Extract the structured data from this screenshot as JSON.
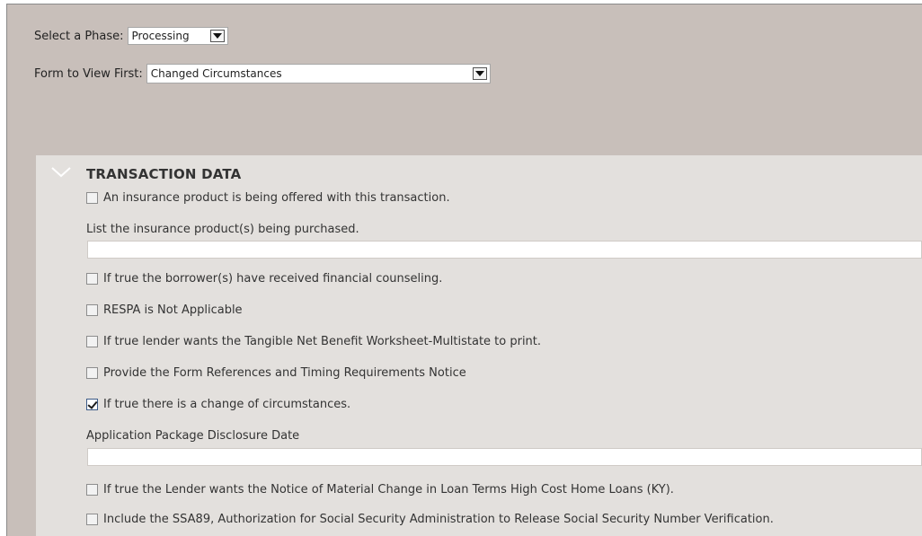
{
  "phase": {
    "label": "Select a Phase:",
    "selected": "Processing"
  },
  "form_view": {
    "label": "Form to View First:",
    "selected": "Changed Circumstances"
  },
  "section": {
    "title": "TRANSACTION DATA",
    "items": [
      {
        "type": "checkbox",
        "label": "An insurance product is being offered with this transaction.",
        "checked": false
      },
      {
        "type": "text",
        "label": "List the insurance product(s) being purchased.",
        "value": ""
      },
      {
        "type": "checkbox",
        "label": "If true the borrower(s) have received financial counseling.",
        "checked": false
      },
      {
        "type": "checkbox",
        "label": "RESPA is Not Applicable",
        "checked": false
      },
      {
        "type": "checkbox",
        "label": "If true lender wants the Tangible Net Benefit Worksheet-Multistate to print.",
        "checked": false
      },
      {
        "type": "checkbox",
        "label": "Provide the Form References and Timing Requirements Notice",
        "checked": false
      },
      {
        "type": "checkbox",
        "label": "If true there is a change of circumstances.",
        "checked": true
      },
      {
        "type": "text",
        "label": "Application Package Disclosure Date",
        "value": ""
      },
      {
        "type": "checkbox",
        "label": "If true the Lender wants the Notice of Material Change in Loan Terms High Cost Home Loans (KY).",
        "checked": false
      },
      {
        "type": "checkbox",
        "label": "Include the SSA89, Authorization for Social Security Administration to Release Social Security Number Verification.",
        "checked": false
      }
    ]
  },
  "colors": {
    "background": "#c8bfba",
    "panel": "#e3e0dd",
    "checkbox_checked_border": "#3b5a87"
  }
}
